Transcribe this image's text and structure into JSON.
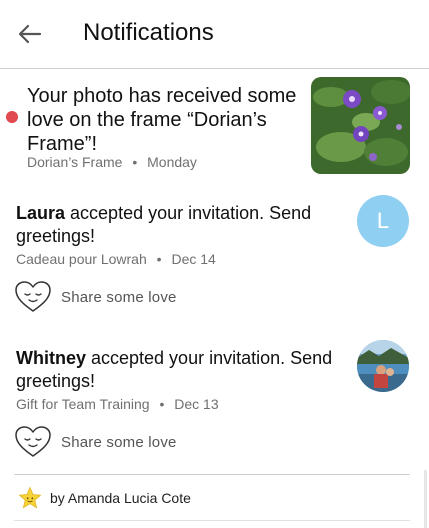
{
  "header": {
    "title": "Notifications"
  },
  "notifications": [
    {
      "text": "Your photo has received some love on the frame “Dorian’s Frame”!",
      "frame": "Dorian’s Frame",
      "date": "Monday",
      "unread": true
    },
    {
      "name": "Laura",
      "text": " accepted your invitation. Send greetings!",
      "frame": "Cadeau pour Lowrah",
      "date": "Dec 14",
      "avatar_letter": "L",
      "avatar_color": "#8fcff2",
      "action": "Share some love"
    },
    {
      "name": "Whitney",
      "text": " accepted your invitation. Send greetings!",
      "frame": "Gift for Team Training",
      "date": "Dec 13",
      "action": "Share some love"
    }
  ],
  "footer": {
    "prefix": "by",
    "author": "Amanda Lucia Cote"
  },
  "colors": {
    "unread_dot": "#e14a4f",
    "avatar_l": "#8fcff2"
  },
  "separator": "•"
}
